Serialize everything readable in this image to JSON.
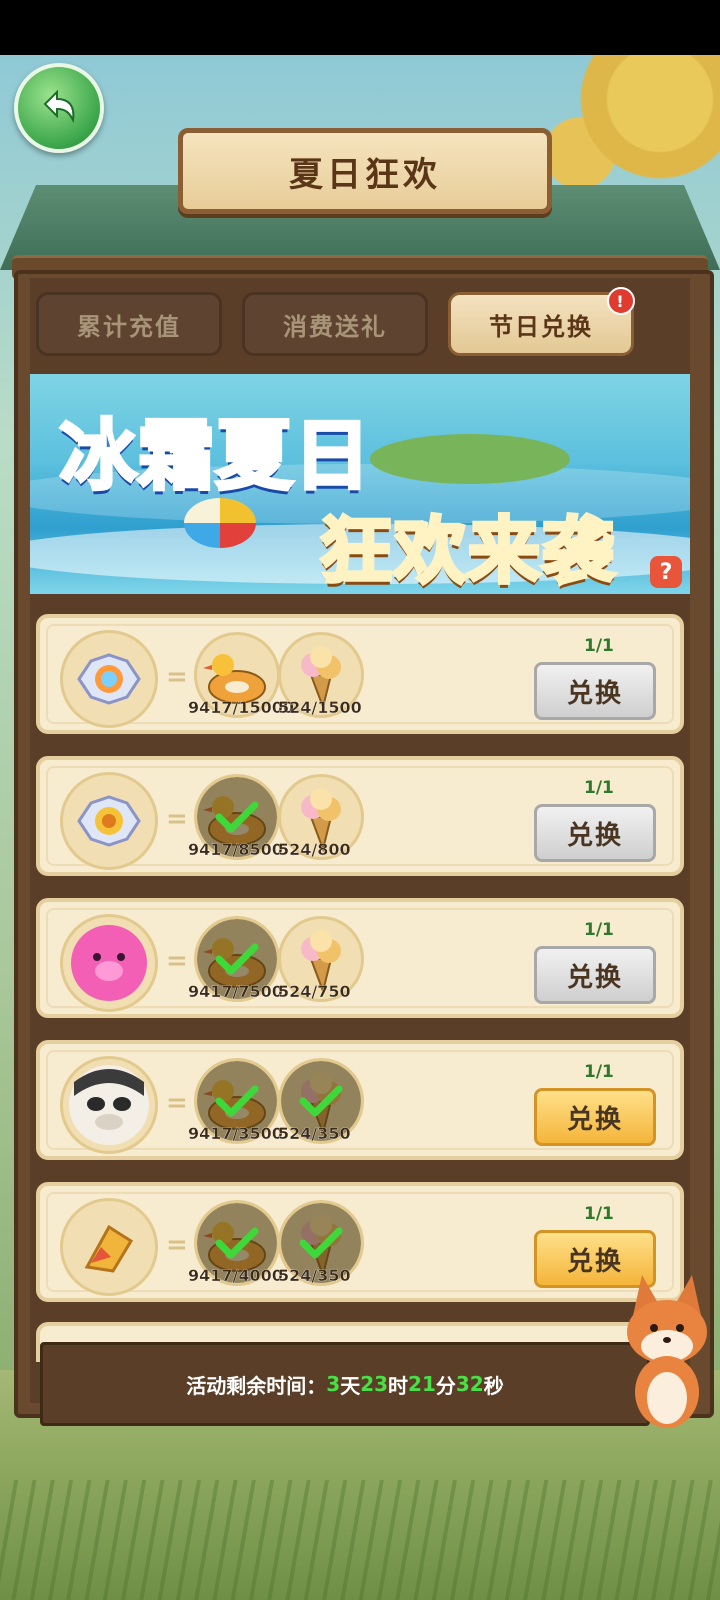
{
  "title": "夏日狂欢",
  "tabs": [
    {
      "label": "累计充值",
      "active": false
    },
    {
      "label": "消费送礼",
      "active": false
    },
    {
      "label": "节日兑换",
      "active": true,
      "alert": "!"
    }
  ],
  "banner": {
    "line1": "冰霜夏日",
    "line2": "狂欢来袭",
    "help": "?"
  },
  "exchange_items": [
    {
      "reward": "ornate-frame-rainbow",
      "limit": "1/1",
      "button": "兑换",
      "button_state": "disabled",
      "costs": [
        {
          "icon": "duck-float-icon",
          "count": "9417/15000",
          "done": false
        },
        {
          "icon": "ice-cream-icon",
          "count": "524/1500",
          "done": false
        }
      ]
    },
    {
      "reward": "ornate-frame-gold",
      "limit": "1/1",
      "button": "兑换",
      "button_state": "disabled",
      "costs": [
        {
          "icon": "duck-float-icon",
          "count": "9417/8500",
          "done": true
        },
        {
          "icon": "ice-cream-icon",
          "count": "524/800",
          "done": false
        }
      ]
    },
    {
      "reward": "pink-pig-avatar",
      "limit": "1/1",
      "button": "兑换",
      "button_state": "disabled",
      "costs": [
        {
          "icon": "duck-float-icon",
          "count": "9417/7500",
          "done": true
        },
        {
          "icon": "ice-cream-icon",
          "count": "524/750",
          "done": false
        }
      ]
    },
    {
      "reward": "panda-avatar",
      "limit": "1/1",
      "button": "兑换",
      "button_state": "active",
      "costs": [
        {
          "icon": "duck-float-icon",
          "count": "9417/3500",
          "done": true
        },
        {
          "icon": "ice-cream-icon",
          "count": "524/350",
          "done": true
        }
      ]
    },
    {
      "reward": "golden-horn-item",
      "limit": "1/1",
      "button": "兑换",
      "button_state": "active",
      "costs": [
        {
          "icon": "duck-float-icon",
          "count": "9417/4000",
          "done": true
        },
        {
          "icon": "ice-cream-icon",
          "count": "524/350",
          "done": true
        }
      ]
    }
  ],
  "timer": {
    "label": "活动剩余时间：",
    "days": "3",
    "days_unit": "天",
    "hours": "23",
    "hours_unit": "时",
    "minutes": "21",
    "minutes_unit": "分",
    "seconds": "32",
    "seconds_unit": "秒"
  },
  "colors": {
    "gold_button": "#f4b53a",
    "gray_button": "#cfcfcf",
    "timer_value": "#49e047",
    "panel": "#5a3e27"
  }
}
